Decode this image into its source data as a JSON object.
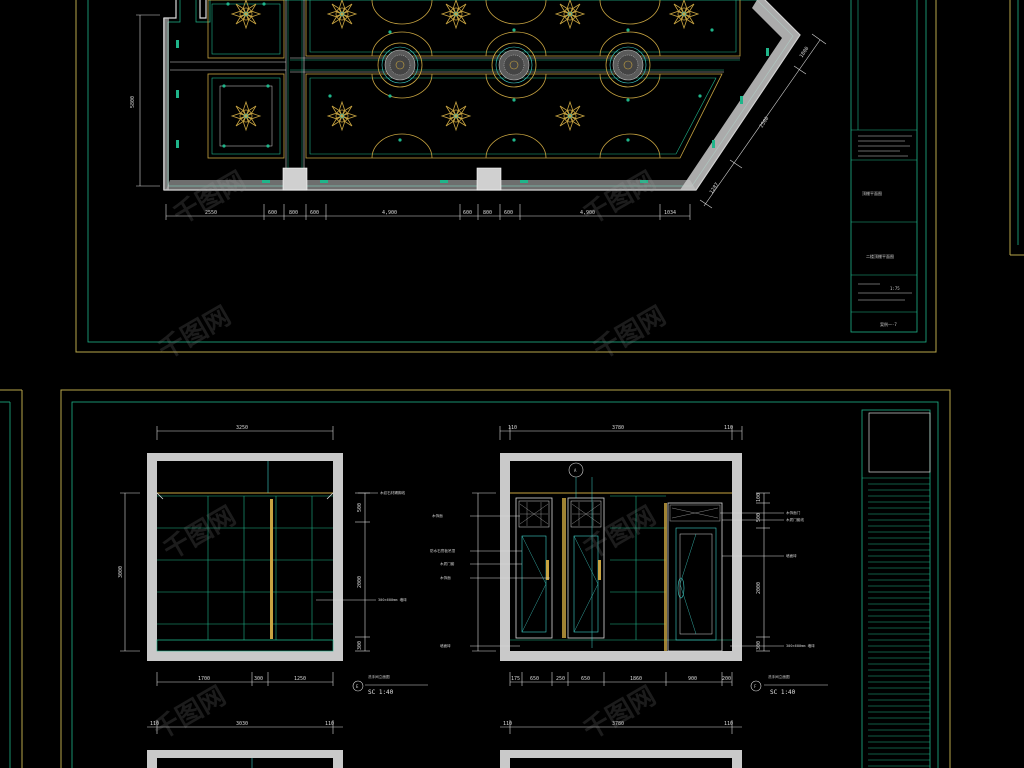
{
  "colors": {
    "background": "#000000",
    "frame_yellow": "#b8a64a",
    "line_green": "#1fb58a",
    "line_white": "#d9d9d9",
    "wall_fill": "#c9c9c9",
    "gold": "#c8a441",
    "cyan": "#3fd0c8",
    "watermark": "#8f8f8f"
  },
  "plan": {
    "left_dim": "5800",
    "bottom_dims": [
      "2550",
      "600",
      "800",
      "600",
      "4,900",
      "600",
      "800",
      "600",
      "4,900",
      "1034"
    ],
    "diag_dims": [
      "1800",
      "2500",
      "1287"
    ]
  },
  "title_block_top": {
    "drawing_name": "顶棚平面图",
    "sub_name": "二楼顶棚平面图",
    "scale": "1:75",
    "sheet_no": "案例一-7"
  },
  "elev_left": {
    "top_dim": "3250",
    "left_dim": "3000",
    "right_dims": [
      "500",
      "2000",
      "300"
    ],
    "bottom_dims": [
      "1700",
      "300",
      "1250"
    ],
    "notes": [
      "木纹石材踢脚线",
      "300×600mm 墙砖"
    ],
    "marker": "E",
    "title": "洗手间立面图",
    "scale": "SC 1:40"
  },
  "elev_right": {
    "top_dims": [
      "110",
      "3780",
      "110"
    ],
    "left_notes": [
      "木饰面",
      "防水石膏板吊顶",
      "木质门套",
      "木饰面",
      "墙面砖"
    ],
    "right_notes": [
      "木饰面门",
      "木质门套线",
      "墙面砖",
      "300×600mm 墙砖"
    ],
    "right_dims": [
      "100",
      "500",
      "2000",
      "300"
    ],
    "bottom_dims": [
      "175",
      "650",
      "250",
      "650",
      "1860",
      "900",
      "200"
    ],
    "marker_top": "A",
    "marker": "F",
    "title": "洗手间立面图",
    "scale": "SC 1:40"
  },
  "lower_dims_left": [
    "110",
    "3030",
    "110"
  ],
  "lower_dims_right": [
    "110",
    "3780",
    "110"
  ],
  "watermark_text": "千图网"
}
